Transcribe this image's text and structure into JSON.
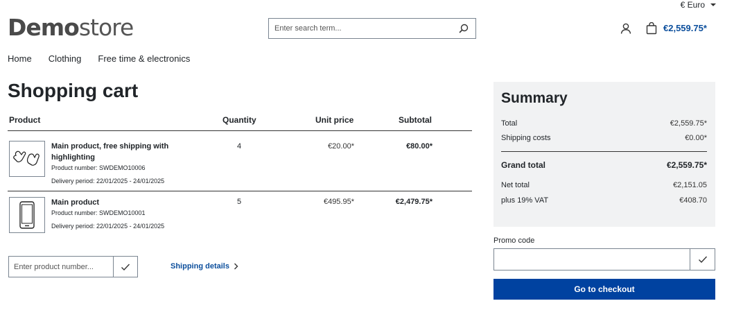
{
  "header": {
    "currency": "€ Euro",
    "logo_bold": "Demo",
    "logo_light": "store",
    "search_placeholder": "Enter search term...",
    "cart_total": "€2,559.75*"
  },
  "nav": {
    "items": [
      "Home",
      "Clothing",
      "Free time & electronics"
    ]
  },
  "page_title": "Shopping cart",
  "cart": {
    "columns": {
      "product": "Product",
      "quantity": "Quantity",
      "unit_price": "Unit price",
      "subtotal": "Subtotal"
    },
    "items": [
      {
        "name": "Main product, free shipping with highlighting",
        "product_number": "Product number: SWDEMO10006",
        "delivery": "Delivery period: 22/01/2025 - 24/01/2025",
        "quantity": "4",
        "unit_price": "€20.00*",
        "subtotal": "€80.00*",
        "icon": "mittens-icon"
      },
      {
        "name": "Main product",
        "product_number": "Product number: SWDEMO10001",
        "delivery": "Delivery period: 22/01/2025 - 24/01/2025",
        "quantity": "5",
        "unit_price": "€495.95*",
        "subtotal": "€2,479.75*",
        "icon": "smartphone-icon"
      }
    ],
    "product_number_placeholder": "Enter product number...",
    "shipping_details": "Shipping details"
  },
  "summary": {
    "title": "Summary",
    "total_label": "Total",
    "total_value": "€2,559.75*",
    "shipping_label": "Shipping costs",
    "shipping_value": "€0.00*",
    "grand_label": "Grand total",
    "grand_value": "€2,559.75*",
    "net_label": "Net total",
    "net_value": "€2,151.05",
    "vat_label": "plus 19% VAT",
    "vat_value": "€408.70"
  },
  "promo": {
    "label": "Promo code"
  },
  "checkout_label": "Go to checkout",
  "colors": {
    "brand_blue": "#0042a0",
    "link_blue": "#0b4e9c",
    "summary_bg": "#f1f2f3"
  }
}
